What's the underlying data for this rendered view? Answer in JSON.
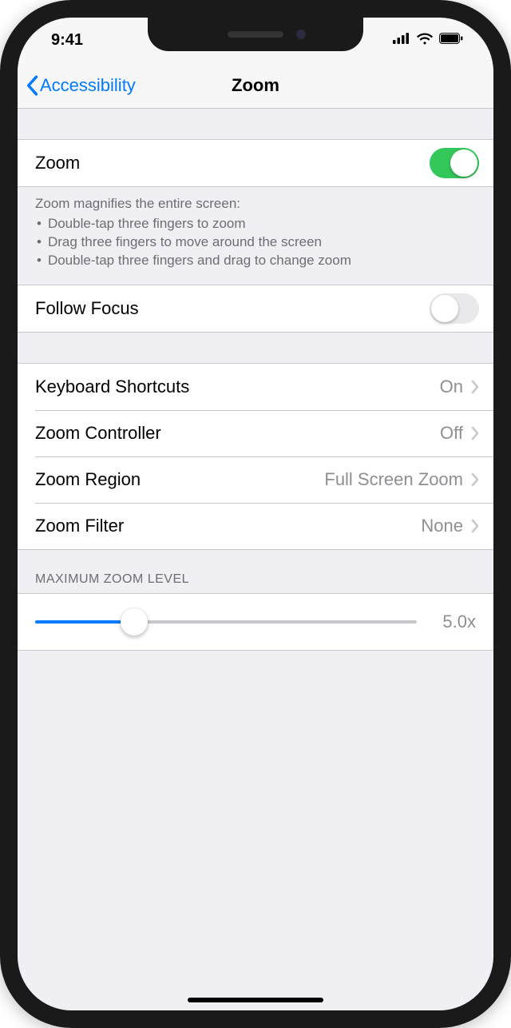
{
  "status": {
    "time": "9:41"
  },
  "nav": {
    "back_label": "Accessibility",
    "title": "Zoom"
  },
  "zoom_toggle": {
    "label": "Zoom",
    "on": true
  },
  "zoom_description": {
    "title": "Zoom magnifies the entire screen:",
    "bullets": [
      "Double-tap three fingers to zoom",
      "Drag three fingers to move around the screen",
      "Double-tap three fingers and drag to change zoom"
    ]
  },
  "follow_focus": {
    "label": "Follow Focus",
    "on": false
  },
  "rows": {
    "keyboard_shortcuts": {
      "label": "Keyboard Shortcuts",
      "value": "On"
    },
    "zoom_controller": {
      "label": "Zoom Controller",
      "value": "Off"
    },
    "zoom_region": {
      "label": "Zoom Region",
      "value": "Full Screen Zoom"
    },
    "zoom_filter": {
      "label": "Zoom Filter",
      "value": "None"
    }
  },
  "max_zoom": {
    "header": "Maximum Zoom Level",
    "value_label": "5.0x",
    "percent": 26
  }
}
